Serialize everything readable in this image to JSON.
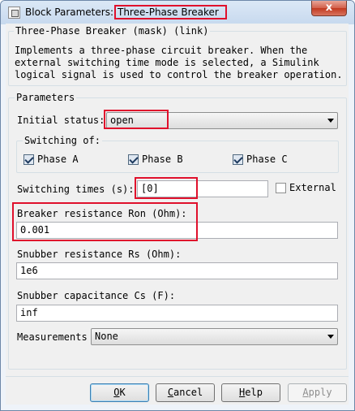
{
  "window": {
    "title_prefix": "Block Parameters:",
    "title_block": "Three-Phase Breaker",
    "close_glyph": "x"
  },
  "mask_group": {
    "label": "Three-Phase Breaker (mask) (link)",
    "description": "Implements a three-phase circuit breaker. When the\nexternal switching time mode is selected, a Simulink\nlogical signal is used to control the breaker operation."
  },
  "params_group": {
    "label": "Parameters",
    "initial_status": {
      "label": "Initial status:",
      "value": "open"
    },
    "switching_of": {
      "label": "Switching of:",
      "phase_a": {
        "label": "Phase A",
        "checked": true
      },
      "phase_b": {
        "label": "Phase B",
        "checked": true
      },
      "phase_c": {
        "label": "Phase C",
        "checked": true
      }
    },
    "switching_times": {
      "label": "Switching times (s):",
      "value": "[0]"
    },
    "external": {
      "label": "External",
      "checked": false
    },
    "breaker_resistance": {
      "label": "Breaker resistance Ron (Ohm):",
      "value": "0.001"
    },
    "snubber_resistance": {
      "label": "Snubber resistance Rs (Ohm):",
      "value": "1e6"
    },
    "snubber_capacitance": {
      "label": "Snubber capacitance Cs (F):",
      "value": "inf"
    },
    "measurements": {
      "label": "Measurements",
      "value": "None"
    }
  },
  "buttons": {
    "ok": {
      "mnemonic": "O",
      "rest": "K"
    },
    "cancel": {
      "mnemonic": "C",
      "rest": "ancel"
    },
    "help": {
      "mnemonic": "H",
      "rest": "elp"
    },
    "apply": {
      "mnemonic": "A",
      "rest": "pply",
      "enabled": false
    }
  },
  "colors": {
    "highlight": "#e0102c",
    "title_bar": "#c7d9ee",
    "dialog_background": "#f0f0f0"
  }
}
